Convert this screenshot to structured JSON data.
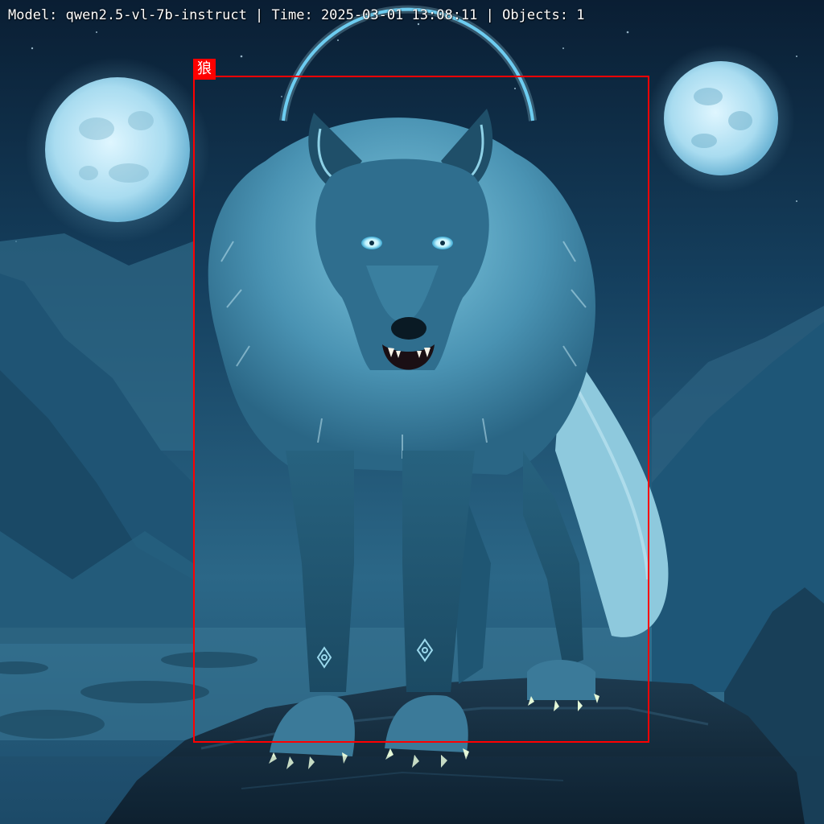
{
  "header": {
    "model_text": "Model: qwen2.5-vl-7b-instruct",
    "separator": " | ",
    "time_text": "Time: 2025-03-01 13:08:11",
    "objects_text": "Objects: 1"
  },
  "detection": {
    "label": "狼",
    "color": "#ff0000"
  },
  "scene": {
    "subject": "wolf",
    "objects": [
      "left-moon",
      "right-moon",
      "halo-ring",
      "mountains",
      "rock-ledge",
      "wolf"
    ]
  }
}
